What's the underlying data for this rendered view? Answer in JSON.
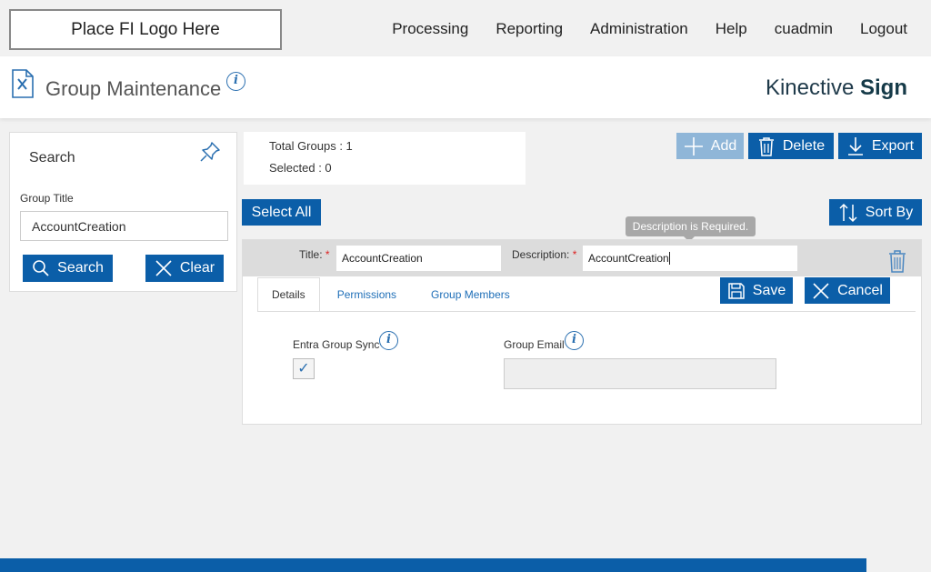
{
  "header": {
    "logo_text": "Place FI Logo Here",
    "nav": [
      "Processing",
      "Reporting",
      "Administration",
      "Help",
      "cuadmin",
      "Logout"
    ]
  },
  "titlebar": {
    "title": "Group Maintenance",
    "brand_light": "Kinective ",
    "brand_bold": "Sign"
  },
  "search": {
    "title": "Search",
    "group_title_label": "Group Title",
    "group_title_value": "AccountCreation",
    "search_label": "Search",
    "clear_label": "Clear"
  },
  "stats": {
    "total_groups": "Total Groups : 1",
    "selected": "Selected : 0"
  },
  "toolbar": {
    "add_label": "Add",
    "delete_label": "Delete",
    "export_label": "Export",
    "select_all_label": "Select All",
    "sort_by_label": "Sort By"
  },
  "tooltip": "Description is Required.",
  "edit": {
    "title_label": "Title:",
    "title_value": "AccountCreation",
    "description_label": "Description:",
    "description_value": "AccountCreation",
    "required_mark": "*",
    "save_label": "Save",
    "cancel_label": "Cancel",
    "tabs": [
      "Details",
      "Permissions",
      "Group Members"
    ],
    "entra_label": "Entra Group Sync",
    "entra_checked": true,
    "group_email_label": "Group Email",
    "group_email_value": ""
  },
  "colors": {
    "primary": "#0b5ea8",
    "disabled": "#8fb6d8",
    "link": "#1f6fb8",
    "required": "#dd2222"
  }
}
